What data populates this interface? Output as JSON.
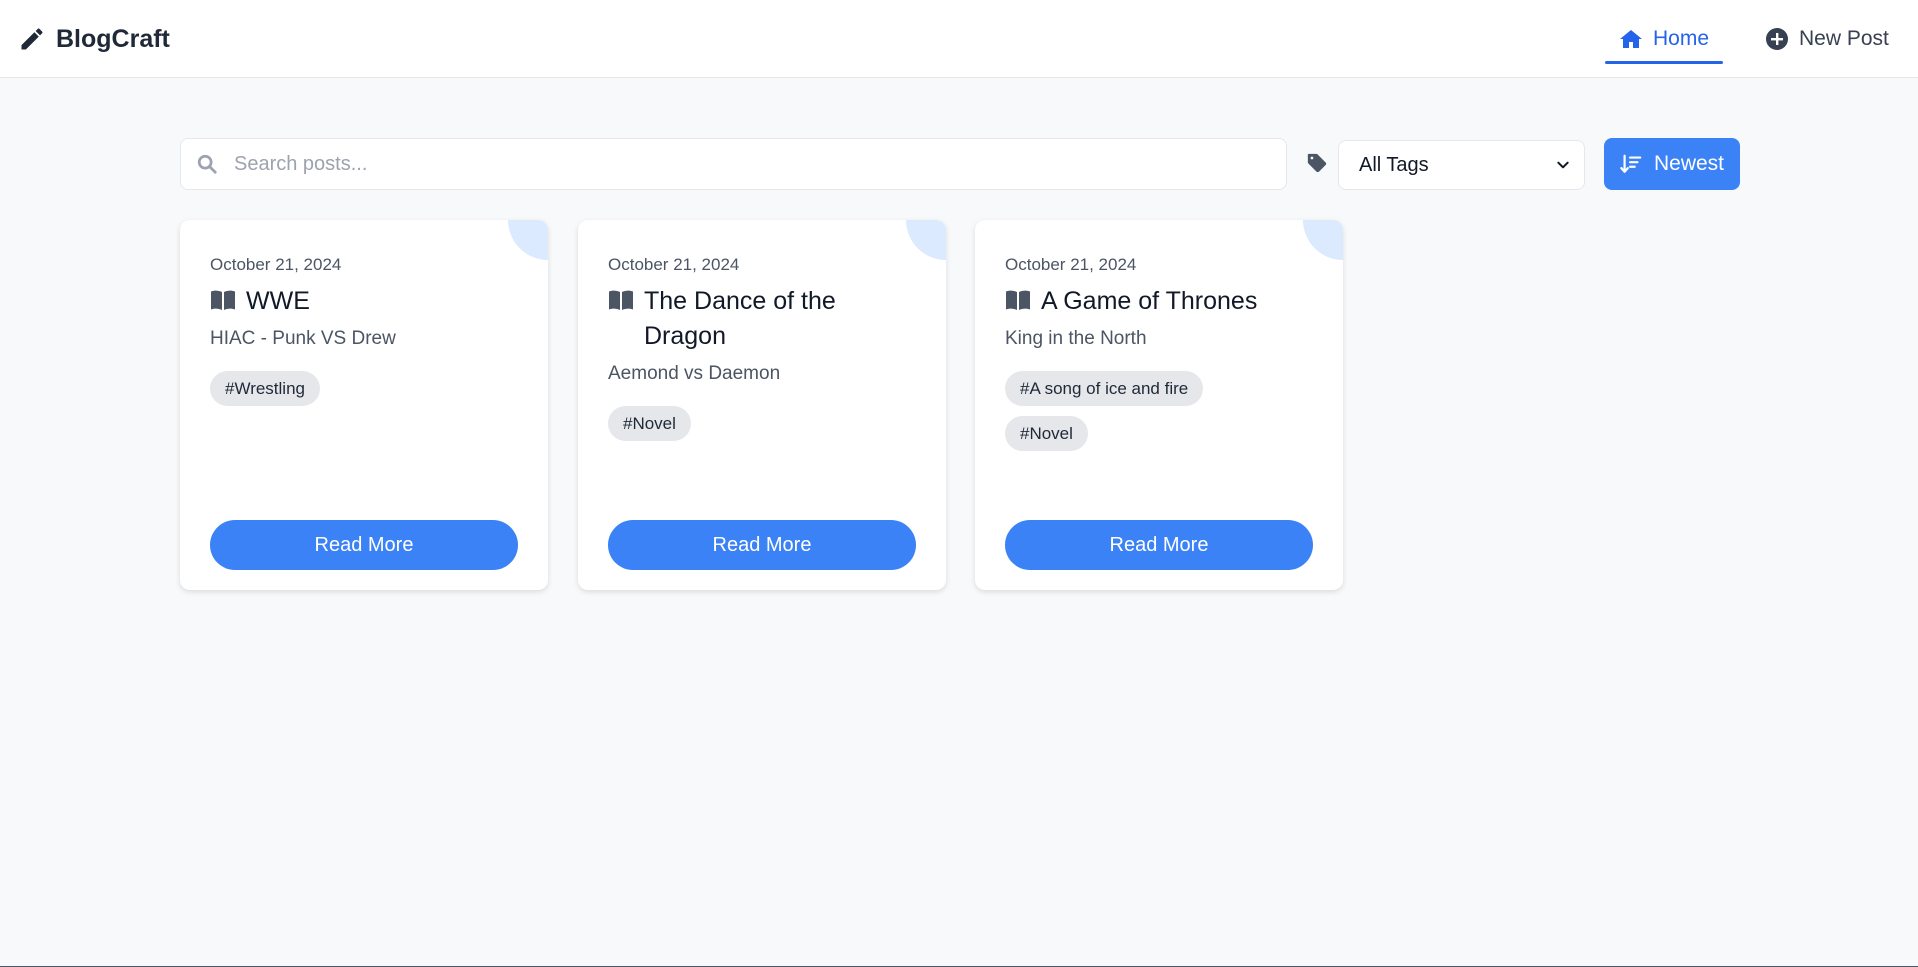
{
  "brand": {
    "name": "BlogCraft"
  },
  "nav": {
    "home_label": "Home",
    "new_post_label": "New Post"
  },
  "toolbar": {
    "search_placeholder": "Search posts...",
    "tag_filter_value": "All Tags",
    "sort_label": "Newest"
  },
  "posts": [
    {
      "date": "October 21, 2024",
      "title": "WWE",
      "subtitle": "HIAC - Punk VS Drew",
      "tags": [
        "#Wrestling"
      ],
      "read_more": "Read More"
    },
    {
      "date": "October 21, 2024",
      "title": "The Dance of the Dragon",
      "subtitle": "Aemond vs Daemon",
      "tags": [
        "#Novel"
      ],
      "read_more": "Read More"
    },
    {
      "date": "October 21, 2024",
      "title": "A Game of Thrones",
      "subtitle": "King in the North",
      "tags": [
        "#A song of ice and fire",
        "#Novel"
      ],
      "read_more": "Read More"
    }
  ],
  "colors": {
    "accent": "#3b82f6",
    "active_nav": "#2563eb",
    "background": "#f8f9fb",
    "tag_bg": "#e5e7eb",
    "card_corner": "#dbeafe"
  },
  "icons": {
    "brand": "pencil-icon",
    "home": "home-icon",
    "new_post": "plus-circle-icon",
    "search": "search-icon",
    "tag": "tag-icon",
    "sort": "sort-descending-icon",
    "post": "book-open-icon"
  }
}
